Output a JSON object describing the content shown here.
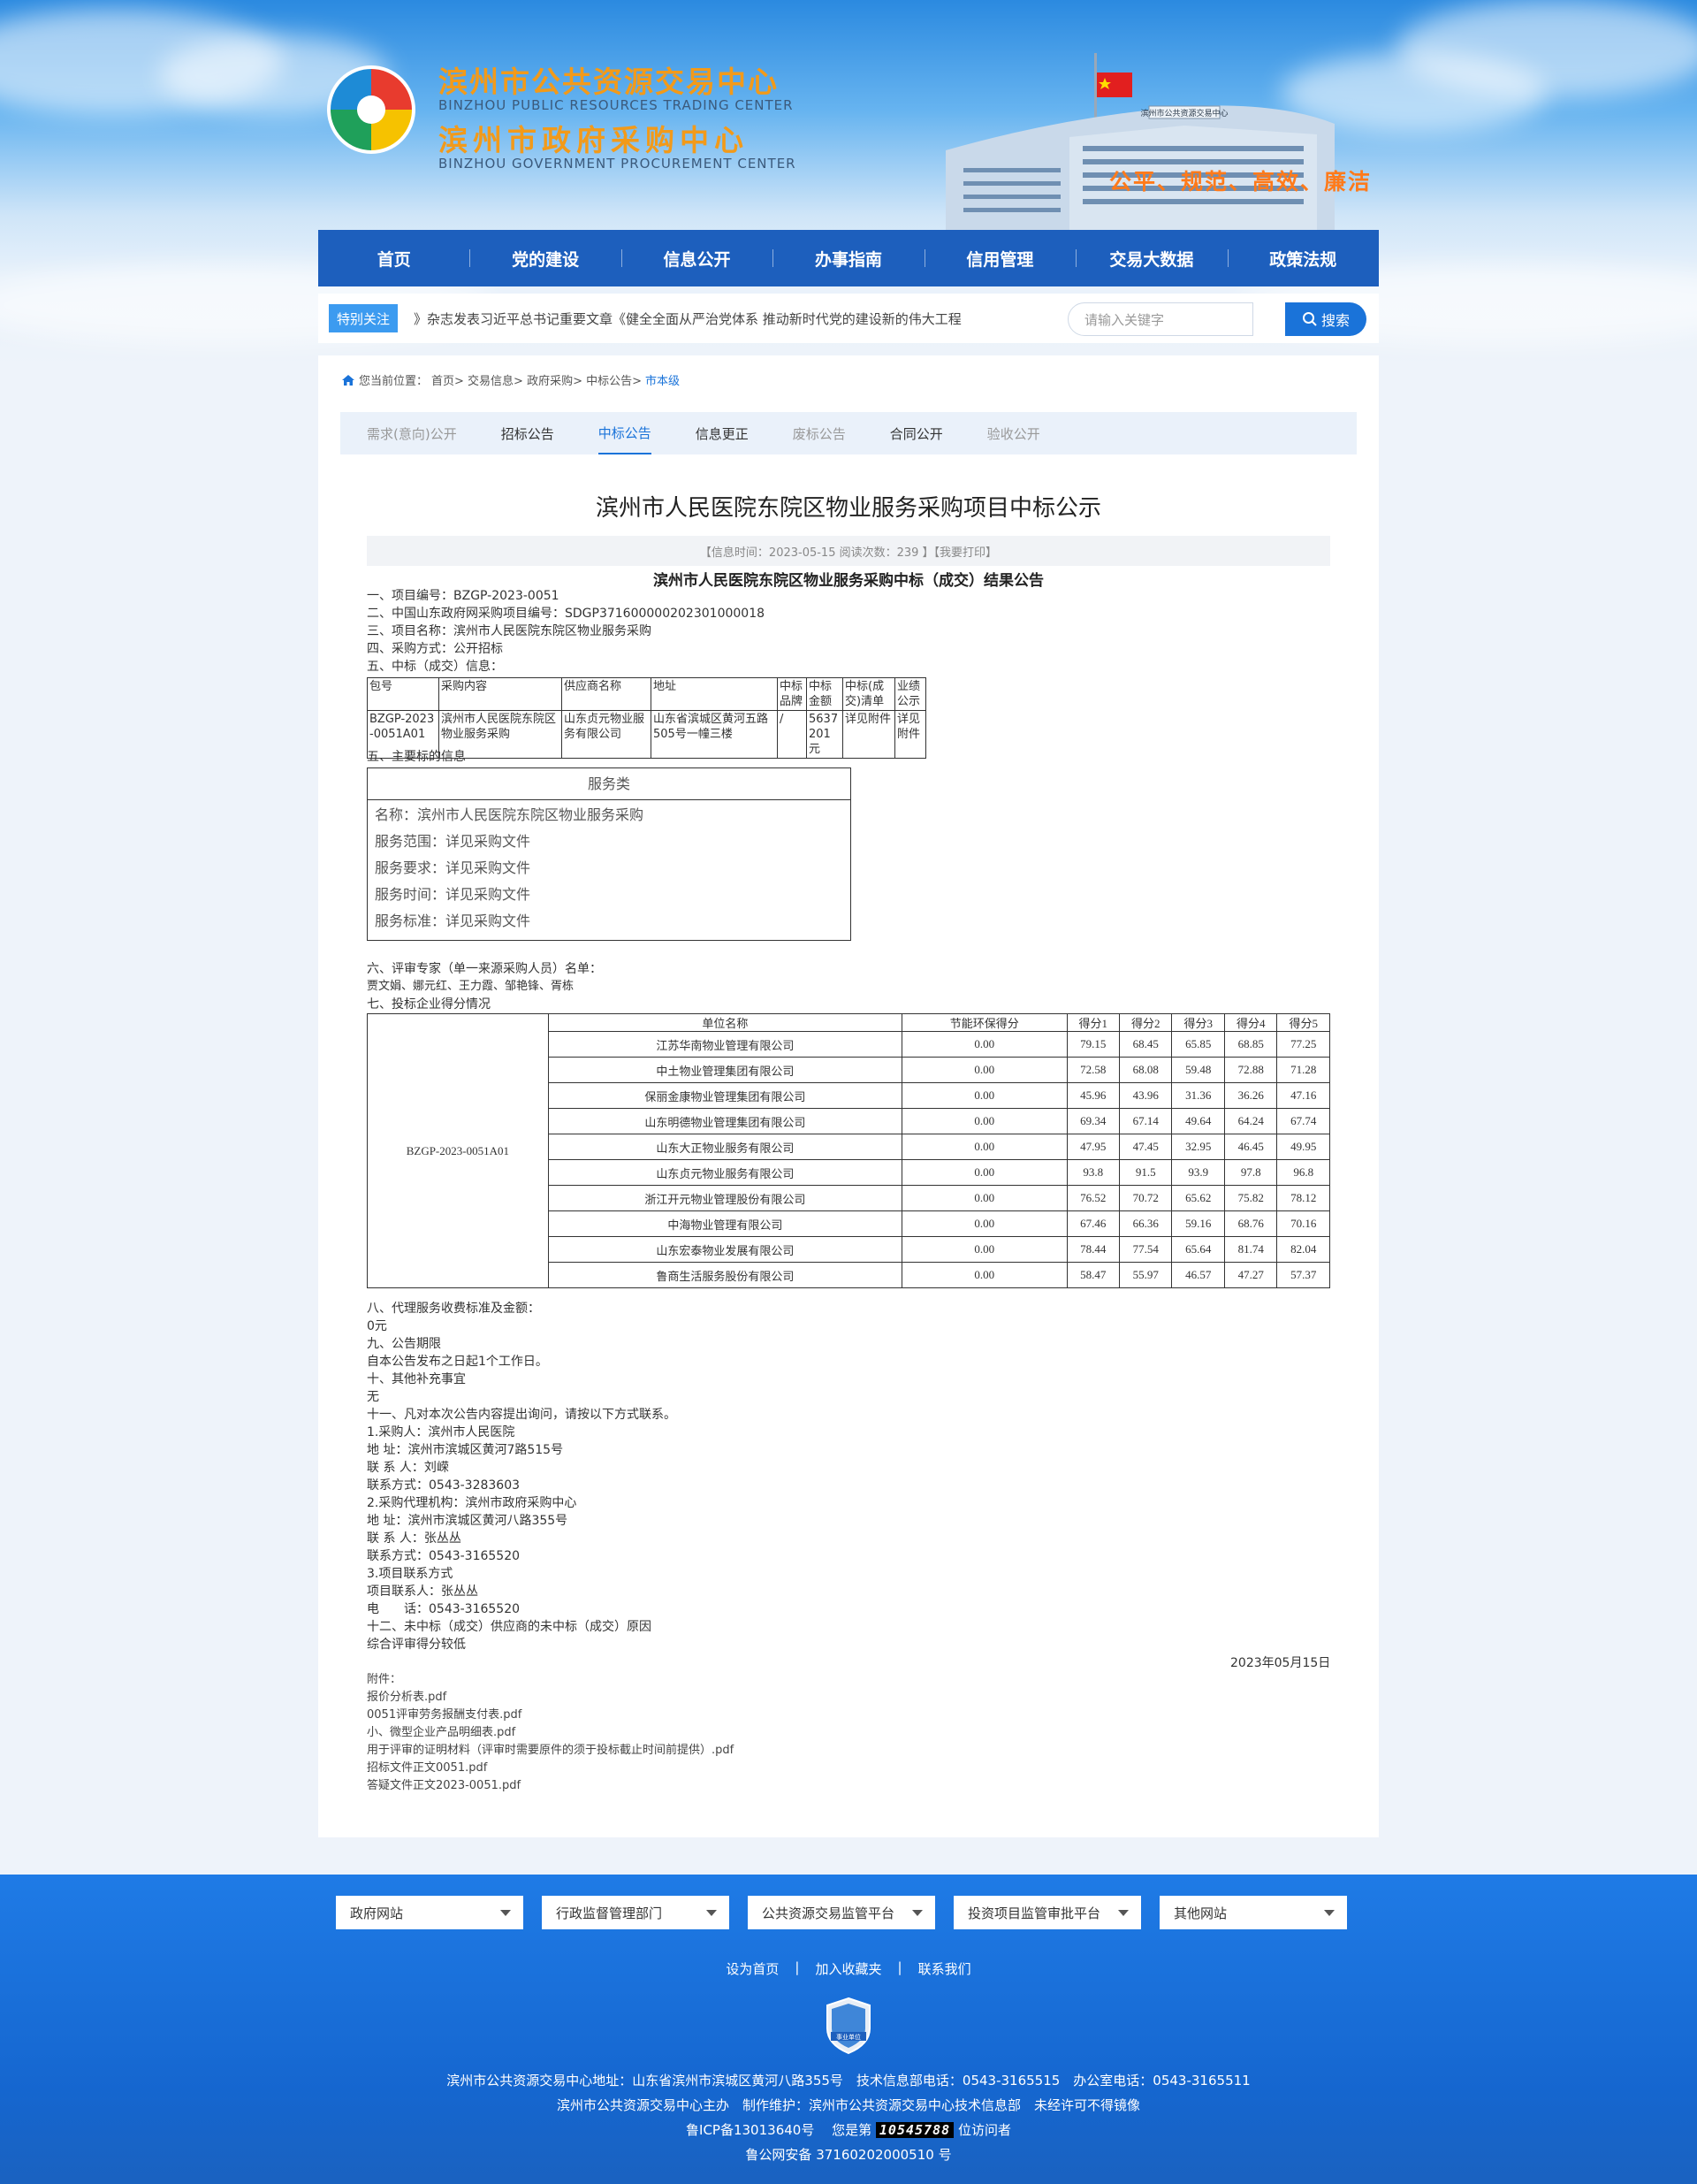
{
  "header": {
    "title_cn_1": "滨州市公共资源交易中心",
    "title_en_1": "BINZHOU PUBLIC RESOURCES TRADING CENTER",
    "title_cn_2": "滨州市政府采购中心",
    "title_en_2": "BINZHOU GOVERNMENT PROCUREMENT CENTER",
    "building_sign": "滨州市公共资源交易中心",
    "slogan": "公平、规范、高效、廉洁"
  },
  "nav": [
    "首页",
    "党的建设",
    "信息公开",
    "办事指南",
    "信用管理",
    "交易大数据",
    "政策法规"
  ],
  "focus": {
    "badge": "特别关注",
    "news": "》杂志发表习近平总书记重要文章《健全全面从严治党体系 推动新时代党的建设新的伟大工程",
    "search_placeholder": "请输入关键字",
    "search_label": "搜索"
  },
  "breadcrumb": {
    "prefix": "您当前位置：",
    "path": "首页> 交易信息> 政府采购> 中标公告>",
    "current": "市本级"
  },
  "tabs": [
    "需求(意向)公开",
    "招标公告",
    "中标公告",
    "信息更正",
    "废标公告",
    "合同公开",
    "验收公开"
  ],
  "article": {
    "title": "滨州市人民医院东院区物业服务采购项目中标公示",
    "info": "【信息时间：2023-05-15  阅读次数：239 】【我要打印】",
    "subtitle": "滨州市人民医院东院区物业服务采购中标（成交）结果公告",
    "lines_top": [
      "一、项目编号：BZGP-2023-0051",
      "二、中国山东政府网采购项目编号：SDGP371600000202301000018",
      "三、项目名称：滨州市人民医院东院区物业服务采购",
      "四、采购方式：公开招标",
      "五、中标（成交）信息："
    ],
    "win_table": {
      "headers": [
        "包号",
        "采购内容",
        "供应商名称",
        "地址",
        "中标品牌",
        "中标金额",
        "中标(成交)清单",
        "业绩公示"
      ],
      "row": [
        "BZGP-2023-0051A01",
        "滨州市人民医院东院区物业服务采购",
        "山东贞元物业服务有限公司",
        "山东省滨城区黄河五路505号一幢三楼",
        "/",
        "5637201元",
        "详见附件",
        "详见附件"
      ]
    },
    "main_info_heading": "五、主要标的信息",
    "service": {
      "head": "服务类",
      "rows": [
        "名称：滨州市人民医院东院区物业服务采购",
        "服务范围：详见采购文件",
        "服务要求：详见采购文件",
        "服务时间：详见采购文件",
        "服务标准：详见采购文件"
      ]
    },
    "experts_heading": "六、评审专家（单一来源采购人员）名单：",
    "experts": "贾文娟、娜元红、王力霞、邹艳锋、胥栋",
    "score_heading": "七、投标企业得分情况",
    "score_table": {
      "package": "BZGP-2023-0051A01",
      "headers": [
        "单位名称",
        "节能环保得分",
        "得分1",
        "得分2",
        "得分3",
        "得分4",
        "得分5"
      ],
      "rows": [
        [
          "江苏华南物业管理有限公司",
          "0.00",
          "79.15",
          "68.45",
          "65.85",
          "68.85",
          "77.25"
        ],
        [
          "中土物业管理集团有限公司",
          "0.00",
          "72.58",
          "68.08",
          "59.48",
          "72.88",
          "71.28"
        ],
        [
          "保丽金康物业管理集团有限公司",
          "0.00",
          "45.96",
          "43.96",
          "31.36",
          "36.26",
          "47.16"
        ],
        [
          "山东明德物业管理集团有限公司",
          "0.00",
          "69.34",
          "67.14",
          "49.64",
          "64.24",
          "67.74"
        ],
        [
          "山东大正物业服务有限公司",
          "0.00",
          "47.95",
          "47.45",
          "32.95",
          "46.45",
          "49.95"
        ],
        [
          "山东贞元物业服务有限公司",
          "0.00",
          "93.8",
          "91.5",
          "93.9",
          "97.8",
          "96.8"
        ],
        [
          "浙江开元物业管理股份有限公司",
          "0.00",
          "76.52",
          "70.72",
          "65.62",
          "75.82",
          "78.12"
        ],
        [
          "中海物业管理有限公司",
          "0.00",
          "67.46",
          "66.36",
          "59.16",
          "68.76",
          "70.16"
        ],
        [
          "山东宏泰物业发展有限公司",
          "0.00",
          "78.44",
          "77.54",
          "65.64",
          "81.74",
          "82.04"
        ],
        [
          "鲁商生活服务股份有限公司",
          "0.00",
          "58.47",
          "55.97",
          "46.57",
          "47.27",
          "57.37"
        ]
      ]
    },
    "lines_bottom": [
      "八、代理服务收费标准及金额：",
      "0元",
      "九、公告期限",
      "自本公告发布之日起1个工作日。",
      "十、其他补充事宜",
      "无",
      "十一、凡对本次公告内容提出询问，请按以下方式联系。",
      "1.采购人：滨州市人民医院",
      "地 址：滨州市滨城区黄河7路515号",
      "联 系 人：刘嵘",
      "联系方式：0543-3283603",
      "2.采购代理机构：滨州市政府采购中心",
      "地 址：滨州市滨城区黄河八路355号",
      "联 系 人：张丛丛",
      "联系方式：0543-3165520",
      "3.项目联系方式",
      "项目联系人：张丛丛",
      "电　　话：0543-3165520",
      "十二、未中标（成交）供应商的未中标（成交）原因",
      "综合评审得分较低"
    ],
    "date": "2023年05月15日",
    "attachments_label": "附件：",
    "attachments": [
      "报价分析表.pdf",
      "0051评审劳务报酬支付表.pdf",
      "小、微型企业产品明细表.pdf",
      "用于评审的证明材料（评审时需要原件的须于投标截止时间前提供）.pdf",
      "招标文件正文0051.pdf",
      "答疑文件正文2023-0051.pdf"
    ]
  },
  "footer": {
    "selects": [
      "政府网站",
      "行政监督管理部门",
      "公共资源交易监管平台",
      "投资项目监管审批平台",
      "其他网站"
    ],
    "links": [
      "设为首页",
      "加入收藏夹",
      "联系我们"
    ],
    "emblem_text": "事业单位",
    "address_line": "滨州市公共资源交易中心地址：山东省滨州市滨城区黄河八路355号　技术信息部电话：0543-3165515　办公室电话：0543-3165511",
    "host_line": "滨州市公共资源交易中心主办　制作维护：滨州市公共资源交易中心技术信息部　未经许可不得镜像",
    "icp": "鲁ICP备13013640号",
    "visitor_prefix": "您是第",
    "visitor_count": "10545788",
    "visitor_suffix": "位访问者",
    "police": "鲁公网安备 37160202000510 号"
  }
}
